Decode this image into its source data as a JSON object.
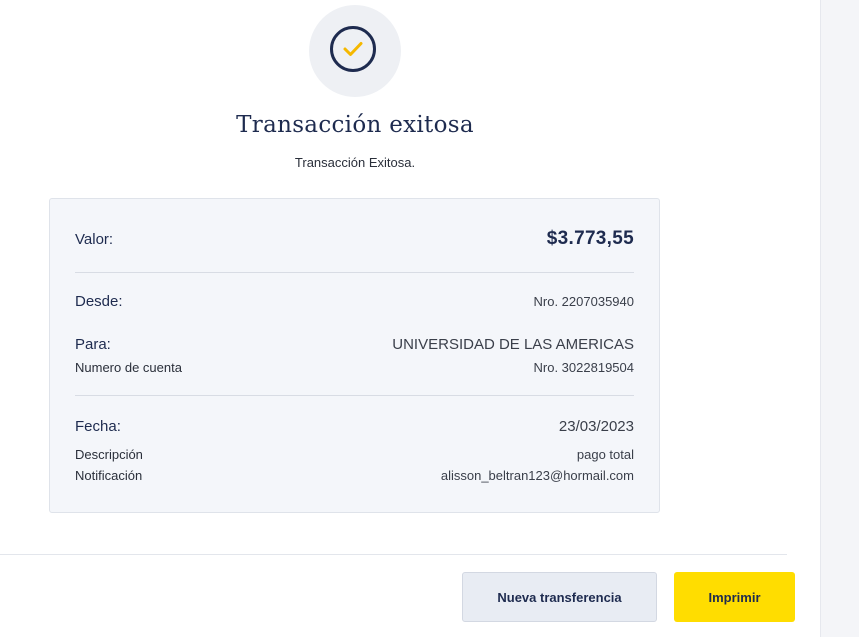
{
  "success": {
    "title": "Transacción exitosa",
    "subtitle": "Transacción Exitosa."
  },
  "details": {
    "amount_label": "Valor:",
    "amount_value": "$3.773,55",
    "from_label": "Desde:",
    "from_value": "Nro. 2207035940",
    "to_label": "Para:",
    "to_value": "UNIVERSIDAD DE LAS AMERICAS",
    "account_label": "Numero de cuenta",
    "account_value": "Nro. 3022819504",
    "date_label": "Fecha:",
    "date_value": "23/03/2023",
    "description_label": "Descripción",
    "description_value": "pago total",
    "notification_label": "Notificación",
    "notification_value": "alisson_beltran123@hormail.com"
  },
  "actions": {
    "new_transfer_label": "Nueva transferencia",
    "print_label": "Imprimir"
  },
  "colors": {
    "primary": "#1e2b4f",
    "accent": "#ffdd00",
    "check": "#f5b800"
  }
}
